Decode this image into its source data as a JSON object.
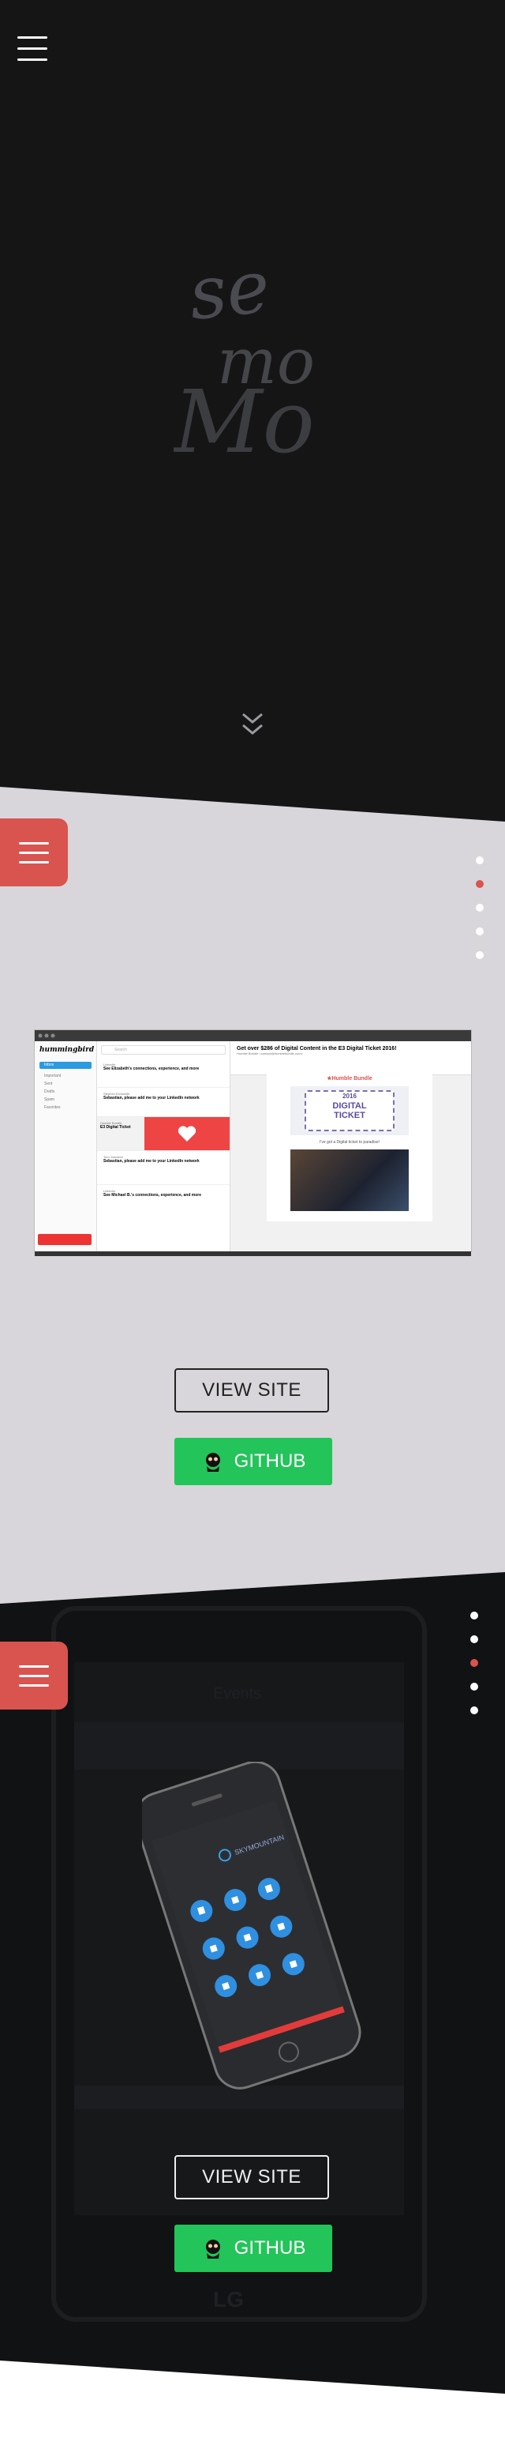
{
  "hero": {
    "logo_alt": "semomo",
    "logo_lines": [
      "se",
      "mo",
      "Mo"
    ]
  },
  "projects": [
    {
      "id": "hummingbird",
      "view_label": "VIEW SITE",
      "github_label": "GITHUB",
      "app": {
        "brand": "hummingbird",
        "compose_label": "Inbox",
        "search_placeholder": "Search",
        "email_subject": "Get over $286 of Digital Content in the E3 Digital Ticket 2016!",
        "email_from": "Humble Bundle <contact@humblebundle.com>",
        "bundle_title": "★Humble Bundle",
        "ticket_line1": "2016",
        "ticket_line2": "DIGITAL",
        "ticket_line3": "TICKET",
        "caption": "I've got a Digital ticket to paradise!",
        "list": [
          {
            "sender": "LinkedIn",
            "subject": "See Elizabeth's connections, experience, and more"
          },
          {
            "sender": "Stephen Eichsmith",
            "subject": "Sebastian, please add me to your LinkedIn network"
          },
          {
            "sender": "Humble Bundle",
            "subject": "E3 Digital Ticket"
          },
          {
            "sender": "Tom Johnston",
            "subject": "Sebastian, please add me to your LinkedIn network"
          },
          {
            "sender": "LinkedIn",
            "subject": "See Michael B.'s connections, experience, and more"
          }
        ],
        "folders": [
          "Inbox",
          "Important",
          "Sent",
          "Drafts",
          "Spam",
          "Favorites"
        ]
      }
    },
    {
      "id": "skymountain",
      "view_label": "VIEW SITE",
      "github_label": "GITHUB",
      "app_brand": "SKYMOUNTAIN"
    }
  ],
  "colors": {
    "hero_bg": "#151516",
    "light_bg": "#d8d6da",
    "dark_bg": "#111213",
    "accent_red": "#d9534f",
    "github_green": "#23c45a"
  },
  "nav_dots": {
    "section2": {
      "count": 5,
      "active": 1
    },
    "section3": {
      "count": 5,
      "active": 2
    }
  }
}
